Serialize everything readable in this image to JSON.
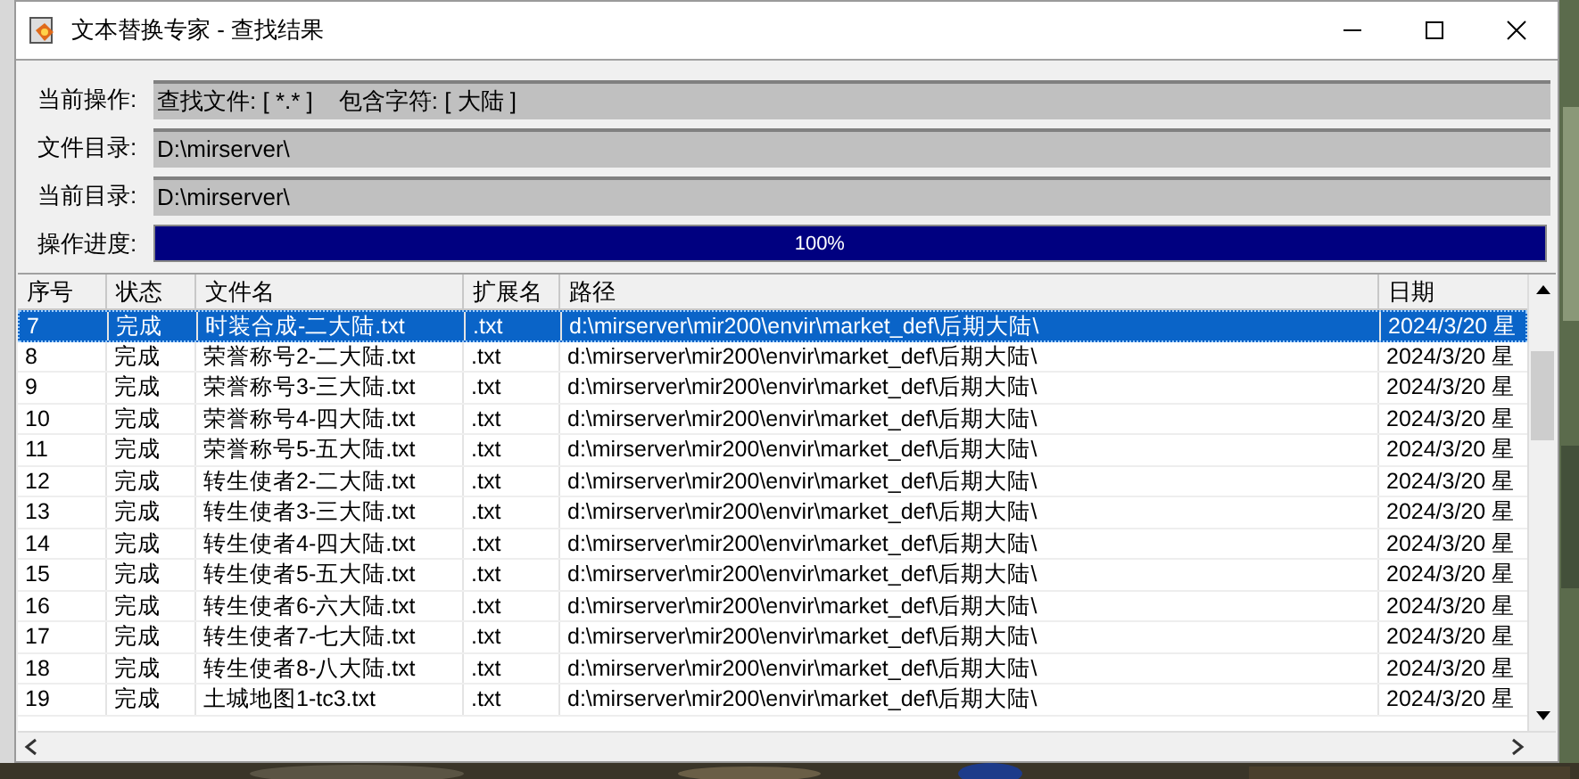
{
  "window": {
    "title": "文本替换专家 - 查找结果"
  },
  "fields": [
    {
      "label": "当前操作:",
      "value": "查找文件: [ *.* ]    包含字符: [ 大陆 ]"
    },
    {
      "label": "文件目录:",
      "value": "D:\\mirserver\\"
    },
    {
      "label": "当前目录:",
      "value": "D:\\mirserver\\"
    }
  ],
  "progress": {
    "label": "操作进度:",
    "level": 1,
    "reading": "100%"
  },
  "table": {
    "columns": [
      "序号",
      "状态",
      "文件名",
      "扩展名",
      "路径",
      "日期"
    ],
    "rows": [
      {
        "selected": true,
        "cells": [
          "7",
          "完成",
          "时装合成-二大陆.txt",
          ".txt",
          "d:\\mirserver\\mir200\\envir\\market_def\\后期大陆\\",
          "2024/3/20 星"
        ]
      },
      {
        "selected": false,
        "cells": [
          "8",
          "完成",
          "荣誉称号2-二大陆.txt",
          ".txt",
          "d:\\mirserver\\mir200\\envir\\market_def\\后期大陆\\",
          "2024/3/20 星"
        ]
      },
      {
        "selected": false,
        "cells": [
          "9",
          "完成",
          "荣誉称号3-三大陆.txt",
          ".txt",
          "d:\\mirserver\\mir200\\envir\\market_def\\后期大陆\\",
          "2024/3/20 星"
        ]
      },
      {
        "selected": false,
        "cells": [
          "10",
          "完成",
          "荣誉称号4-四大陆.txt",
          ".txt",
          "d:\\mirserver\\mir200\\envir\\market_def\\后期大陆\\",
          "2024/3/20 星"
        ]
      },
      {
        "selected": false,
        "cells": [
          "11",
          "完成",
          "荣誉称号5-五大陆.txt",
          ".txt",
          "d:\\mirserver\\mir200\\envir\\market_def\\后期大陆\\",
          "2024/3/20 星"
        ]
      },
      {
        "selected": false,
        "cells": [
          "12",
          "完成",
          "转生使者2-二大陆.txt",
          ".txt",
          "d:\\mirserver\\mir200\\envir\\market_def\\后期大陆\\",
          "2024/3/20 星"
        ]
      },
      {
        "selected": false,
        "cells": [
          "13",
          "完成",
          "转生使者3-三大陆.txt",
          ".txt",
          "d:\\mirserver\\mir200\\envir\\market_def\\后期大陆\\",
          "2024/3/20 星"
        ]
      },
      {
        "selected": false,
        "cells": [
          "14",
          "完成",
          "转生使者4-四大陆.txt",
          ".txt",
          "d:\\mirserver\\mir200\\envir\\market_def\\后期大陆\\",
          "2024/3/20 星"
        ]
      },
      {
        "selected": false,
        "cells": [
          "15",
          "完成",
          "转生使者5-五大陆.txt",
          ".txt",
          "d:\\mirserver\\mir200\\envir\\market_def\\后期大陆\\",
          "2024/3/20 星"
        ]
      },
      {
        "selected": false,
        "cells": [
          "16",
          "完成",
          "转生使者6-六大陆.txt",
          ".txt",
          "d:\\mirserver\\mir200\\envir\\market_def\\后期大陆\\",
          "2024/3/20 星"
        ]
      },
      {
        "selected": false,
        "cells": [
          "17",
          "完成",
          "转生使者7-七大陆.txt",
          ".txt",
          "d:\\mirserver\\mir200\\envir\\market_def\\后期大陆\\",
          "2024/3/20 星"
        ]
      },
      {
        "selected": false,
        "cells": [
          "18",
          "完成",
          "转生使者8-八大陆.txt",
          ".txt",
          "d:\\mirserver\\mir200\\envir\\market_def\\后期大陆\\",
          "2024/3/20 星"
        ]
      },
      {
        "selected": false,
        "cells": [
          "19",
          "完成",
          "土城地图1-tc3.txt",
          ".txt",
          "d:\\mirserver\\mir200\\envir\\market_def\\后期大陆\\",
          "2024/3/20 星"
        ]
      }
    ]
  }
}
